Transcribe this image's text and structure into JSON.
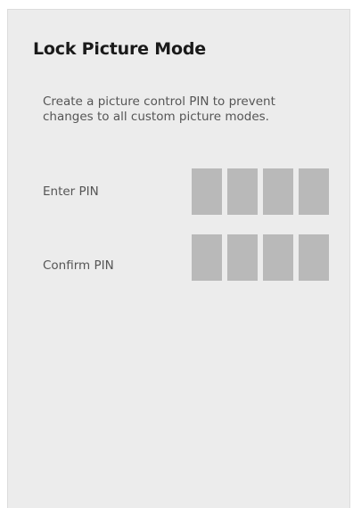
{
  "dialog": {
    "title": "Lock Picture Mode",
    "description": "Create a picture control PIN to prevent changes to all custom picture modes.",
    "enter_pin": {
      "label": "Enter PIN",
      "digits": [
        "",
        "",
        "",
        ""
      ]
    },
    "confirm_pin": {
      "label": "Confirm PIN",
      "digits": [
        "",
        "",
        "",
        ""
      ]
    }
  }
}
